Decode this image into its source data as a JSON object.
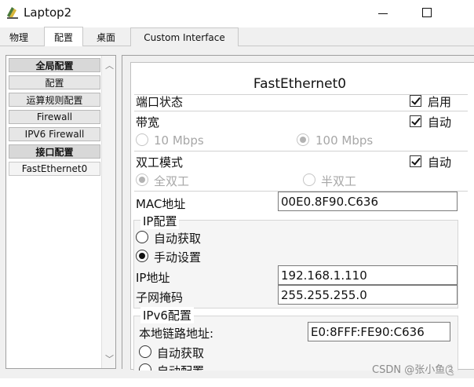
{
  "window": {
    "title": "Laptop2"
  },
  "tabs": [
    "物理",
    "配置",
    "桌面",
    "Custom Interface"
  ],
  "sidebar": {
    "items": [
      {
        "label": "全局配置",
        "type": "header"
      },
      {
        "label": "配置",
        "type": "item"
      },
      {
        "label": "运算规则配置",
        "type": "item"
      },
      {
        "label": "Firewall",
        "type": "item"
      },
      {
        "label": "IPV6 Firewall",
        "type": "item"
      },
      {
        "label": "接口配置",
        "type": "header"
      },
      {
        "label": "FastEthernet0",
        "type": "item",
        "selected": true
      }
    ]
  },
  "panel": {
    "title": "FastEthernet0",
    "port_status": {
      "label": "端口状态",
      "check_label": "启用",
      "checked": true
    },
    "bandwidth": {
      "label": "带宽",
      "auto_label": "自动",
      "auto_checked": true,
      "opt10": "10 Mbps",
      "opt100": "100 Mbps",
      "selected": "100 Mbps"
    },
    "duplex": {
      "label": "双工模式",
      "auto_label": "自动",
      "auto_checked": true,
      "full": "全双工",
      "half": "半双工",
      "selected": "全双工"
    },
    "mac": {
      "label": "MAC地址",
      "value": "00E0.8F90.C636"
    },
    "ip_config": {
      "title": "IP配置",
      "dhcp": "自动获取",
      "static": "手动设置",
      "selected": "手动设置",
      "ip_label": "IP地址",
      "ip_value": "192.168.1.110",
      "mask_label": "子网掩码",
      "mask_value": "255.255.255.0"
    },
    "ipv6_config": {
      "title": "IPv6配置",
      "link_local_label": "本地链路地址:",
      "link_local_value": "E0:8FFF:FE90:C636",
      "auto": "自动获取",
      "manual": "自动配置"
    }
  },
  "watermark": "CSDN @张小鱼༊"
}
